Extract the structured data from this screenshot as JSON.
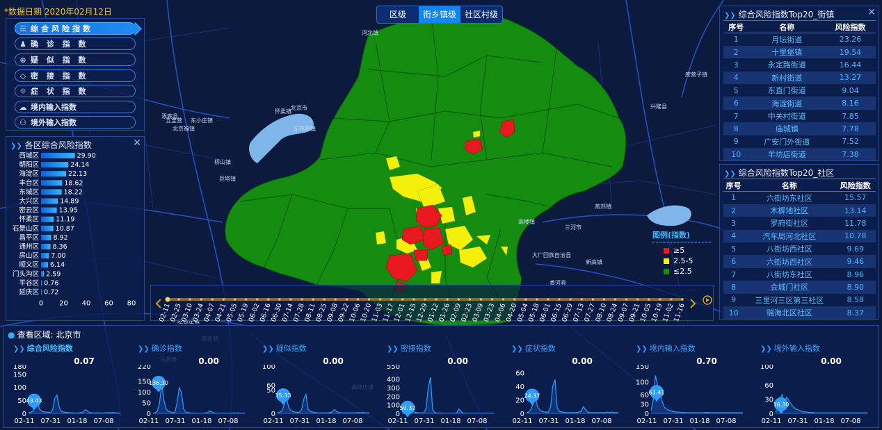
{
  "date_label": "*数据日期 2020年02月12日",
  "city_top_label": "北京市",
  "level_tabs": [
    {
      "label": "区级",
      "active": false
    },
    {
      "label": "街乡镇级",
      "active": true
    },
    {
      "label": "社区村级",
      "active": false
    }
  ],
  "index_menu": [
    {
      "label": "综合风险指数",
      "icon": "layers-icon",
      "active": true
    },
    {
      "label": "确 诊 指 数",
      "icon": "person-icon",
      "active": false
    },
    {
      "label": "疑 似 指 数",
      "icon": "crosshair-icon",
      "active": false
    },
    {
      "label": "密 接 指 数",
      "icon": "diamond-icon",
      "active": false
    },
    {
      "label": "症 状 指 数",
      "icon": "virus-icon",
      "active": false
    },
    {
      "label": "境内输入指数",
      "icon": "cloud-icon",
      "active": false
    },
    {
      "label": "境外输入指数",
      "icon": "people-icon",
      "active": false
    }
  ],
  "district_panel": {
    "title": "各区综合风险指数",
    "chart_data": {
      "type": "bar",
      "orientation": "horizontal",
      "categories": [
        "西城区",
        "朝阳区",
        "海淀区",
        "丰台区",
        "东城区",
        "大兴区",
        "密云区",
        "怀柔区",
        "石景山区",
        "昌平区",
        "通州区",
        "房山区",
        "顺义区",
        "门头沟区",
        "平谷区",
        "延庆区"
      ],
      "values": [
        29.9,
        24.14,
        22.13,
        18.62,
        18.22,
        14.89,
        13.95,
        11.19,
        10.87,
        8.92,
        8.36,
        7.0,
        6.14,
        2.59,
        0.76,
        0.72
      ],
      "value_labels": [
        "29.90",
        "24.14",
        "22.13",
        "18.62",
        "18.22",
        "14.89",
        "13.95",
        "11.19",
        "10.87",
        "8.92",
        "8.36",
        "7.00",
        "6.14",
        "2.59",
        "0.76",
        "0.72"
      ],
      "xlim": [
        0,
        80
      ],
      "xticks": [
        "0",
        "20",
        "40",
        "60",
        "80"
      ],
      "bar_color": "#1a8cf0"
    }
  },
  "top_streets": {
    "title": "综合风险指数Top20_街镇",
    "headers": [
      "序号",
      "名称",
      "风险指数"
    ],
    "rows": [
      [
        "1",
        "月坛街道",
        "23.26"
      ],
      [
        "2",
        "十里堡镇",
        "19.54"
      ],
      [
        "3",
        "永定路街道",
        "16.44"
      ],
      [
        "4",
        "新村街道",
        "13.27"
      ],
      [
        "5",
        "东直门街道",
        "9.04"
      ],
      [
        "6",
        "海淀街道",
        "8.16"
      ],
      [
        "7",
        "中关村街道",
        "7.85"
      ],
      [
        "8",
        "庙城镇",
        "7.78"
      ],
      [
        "9",
        "广安门外街道",
        "7.52"
      ],
      [
        "10",
        "羊坊店街道",
        "7.38"
      ]
    ]
  },
  "top_communities": {
    "title": "综合风险指数Top20_社区",
    "headers": [
      "序号",
      "名称",
      "风险指数"
    ],
    "rows": [
      [
        "1",
        "六街坊东社区",
        "15.57"
      ],
      [
        "2",
        "木樨地社区",
        "13.14"
      ],
      [
        "3",
        "罗府街社区",
        "11.78"
      ],
      [
        "4",
        "汽车局河北社区",
        "10.78"
      ],
      [
        "5",
        "八街坊西社区",
        "9.69"
      ],
      [
        "6",
        "六街坊西社区",
        "9.46"
      ],
      [
        "7",
        "八街坊东社区",
        "8.96"
      ],
      [
        "8",
        "会城门社区",
        "8.90"
      ],
      [
        "9",
        "三里河三区第三社区",
        "8.58"
      ],
      [
        "10",
        "瑞海北区社区",
        "8.37"
      ]
    ]
  },
  "legend": {
    "title": "图例(指数)",
    "items": [
      {
        "label": "≥5",
        "color": "#e8191e"
      },
      {
        "label": "2.5-5",
        "color": "#f5f00a"
      },
      {
        "label": "≤2.5",
        "color": "#138c10"
      }
    ]
  },
  "timeline": {
    "dates": [
      "02-11",
      "02-25",
      "03-10",
      "03-24",
      "04-07",
      "04-21",
      "05-05",
      "05-19",
      "06-02",
      "06-16",
      "06-30",
      "07-14",
      "07-28",
      "08-11",
      "08-25",
      "09-08",
      "09-22",
      "10-06",
      "10-20",
      "11-03",
      "11-17",
      "12-01",
      "12-15",
      "12-29",
      "01-12",
      "01-26",
      "02-09",
      "02-23",
      "03-09",
      "03-23",
      "04-06",
      "04-20",
      "05-04",
      "05-18",
      "06-01",
      "06-15",
      "06-29",
      "07-13",
      "07-27",
      "08-10",
      "08-24",
      "09-07",
      "09-21",
      "10-05",
      "10-19",
      "11-02",
      "11-16"
    ],
    "current_index": 0
  },
  "map_labels": [
    "北京市",
    "怀柔镇",
    "东小庄镇",
    "五里营",
    "涿鹿县",
    "北京福镇",
    "东花园镇",
    "桥山镇",
    "巨塔镇",
    "河北镇",
    "三河市",
    "燕郊镇",
    "高楼镇",
    "大厂回族自治县",
    "新高镇",
    "兴隆县",
    "香河县",
    "库营子镇",
    "马营镇",
    "赵各庄镇",
    "郎庄镇",
    "高碑店镇"
  ],
  "bottom": {
    "region_label": "查看区域: 北京市",
    "charts": [
      {
        "title": "综合风险指数",
        "value": "0.07",
        "active": true,
        "yticks": [
          "0",
          "50",
          "100",
          "150",
          "180"
        ],
        "ymax": 180,
        "peak_value": 43.43,
        "peak_label": "43.43",
        "xticks": [
          "02-11",
          "07-31",
          "01-18",
          "07-08"
        ],
        "series": [
          2,
          4,
          8,
          20,
          43.43,
          16,
          8,
          6,
          5,
          4,
          3,
          12,
          56,
          70,
          24,
          8,
          5,
          4,
          3,
          2,
          2,
          1,
          1,
          2,
          3,
          5,
          14,
          8,
          3,
          2,
          1,
          2,
          2,
          1,
          1,
          2,
          2,
          3,
          2,
          3,
          2,
          1,
          1
        ]
      },
      {
        "title": "确诊指数",
        "value": "0.00",
        "active": false,
        "yticks": [
          "0",
          "50",
          "100",
          "150",
          "220"
        ],
        "ymax": 220,
        "peak_value": 136.3,
        "peak_label": "136.30",
        "xticks": [
          "02-11",
          "07-31",
          "01-18",
          "07-08"
        ],
        "series": [
          1,
          3,
          10,
          50,
          136.3,
          60,
          20,
          10,
          6,
          4,
          3,
          50,
          120,
          96,
          20,
          6,
          4,
          2,
          1,
          1,
          1,
          0,
          0,
          1,
          2,
          3,
          12,
          6,
          2,
          1,
          0,
          1,
          1,
          0,
          0,
          1,
          1,
          2,
          1,
          2,
          1,
          0,
          0
        ]
      },
      {
        "title": "疑似指数",
        "value": "0.00",
        "active": false,
        "yticks": [
          "0",
          "50",
          "60",
          "100"
        ],
        "ymax": 100,
        "peak_value": 35.33,
        "peak_label": "35.33",
        "xticks": [
          "02-11",
          "07-31",
          "01-18",
          "07-08"
        ],
        "series": [
          1,
          2,
          5,
          18,
          35.33,
          14,
          6,
          4,
          3,
          2,
          2,
          8,
          30,
          40,
          8,
          4,
          3,
          2,
          1,
          1,
          1,
          1,
          1,
          1,
          2,
          3,
          8,
          4,
          2,
          1,
          1,
          1,
          1,
          1,
          1,
          1,
          1,
          2,
          1,
          2,
          1,
          1,
          1
        ]
      },
      {
        "title": "密接指数",
        "value": "0.00",
        "active": false,
        "yticks": [
          "0",
          "100",
          "200",
          "300",
          "400",
          "550"
        ],
        "ymax": 550,
        "peak_value": 50.32,
        "peak_label": "50.32",
        "xticks": [
          "02-11",
          "07-31",
          "01-18",
          "07-08"
        ],
        "series": [
          2,
          6,
          15,
          30,
          50.32,
          30,
          12,
          8,
          6,
          5,
          4,
          60,
          300,
          420,
          40,
          8,
          5,
          4,
          3,
          2,
          2,
          1,
          1,
          2,
          3,
          6,
          50,
          20,
          4,
          2,
          1,
          2,
          2,
          1,
          1,
          2,
          2,
          3,
          2,
          3,
          2,
          1,
          1
        ]
      },
      {
        "title": "症状指数",
        "value": "0.00",
        "active": false,
        "yticks": [
          "0",
          "20",
          "40",
          "60"
        ],
        "ymax": 70,
        "peak_value": 24.37,
        "peak_label": "24.37",
        "xticks": [
          "02-11",
          "07-31",
          "01-18",
          "07-08"
        ],
        "series": [
          1,
          2,
          6,
          14,
          24.37,
          10,
          5,
          3,
          2,
          2,
          2,
          10,
          40,
          50,
          8,
          3,
          2,
          2,
          1,
          1,
          1,
          1,
          1,
          1,
          2,
          3,
          10,
          5,
          2,
          1,
          1,
          1,
          1,
          1,
          1,
          1,
          1,
          2,
          1,
          2,
          1,
          1,
          1
        ]
      },
      {
        "title": "境内输入指数",
        "value": "0.70",
        "active": false,
        "yticks": [
          "0",
          "30",
          "60",
          "100",
          "150"
        ],
        "ymax": 150,
        "peak_value": 63.41,
        "peak_label": "63.41",
        "xticks": [
          "02-11",
          "07-31",
          "01-18",
          "07-08"
        ],
        "series": [
          10,
          40,
          120,
          90,
          63.41,
          40,
          20,
          14,
          10,
          8,
          6,
          5,
          4,
          4,
          3,
          3,
          2,
          2,
          2,
          2,
          2,
          2,
          2,
          2,
          2,
          3,
          3,
          2,
          2,
          2,
          2,
          2,
          2,
          2,
          2,
          2,
          2,
          2,
          2,
          2,
          2,
          2,
          2
        ]
      },
      {
        "title": "境外输入指数",
        "value": "0.00",
        "active": false,
        "yticks": [
          "0",
          "30",
          "60",
          "100"
        ],
        "ymax": 100,
        "peak_value": 16.3,
        "peak_label": "16.30",
        "xticks": [
          "02-11",
          "07-31",
          "01-18",
          "07-08"
        ],
        "series": [
          2,
          8,
          30,
          40,
          16.3,
          34,
          28,
          20,
          14,
          10,
          8,
          6,
          4,
          3,
          3,
          2,
          2,
          2,
          1,
          1,
          1,
          1,
          1,
          1,
          1,
          1,
          1,
          1,
          1,
          1,
          1,
          1,
          1,
          1,
          1,
          1,
          1,
          1,
          1,
          1,
          1,
          1,
          1
        ]
      }
    ]
  },
  "colors": {
    "background": "#0c1a3e",
    "map_green": "#138c10",
    "map_yellow": "#f5f00a",
    "map_red": "#e8191e",
    "accent_blue": "#1186f0",
    "table_text": "#4fb4ff",
    "timeline_gold": "#d6a21a"
  }
}
